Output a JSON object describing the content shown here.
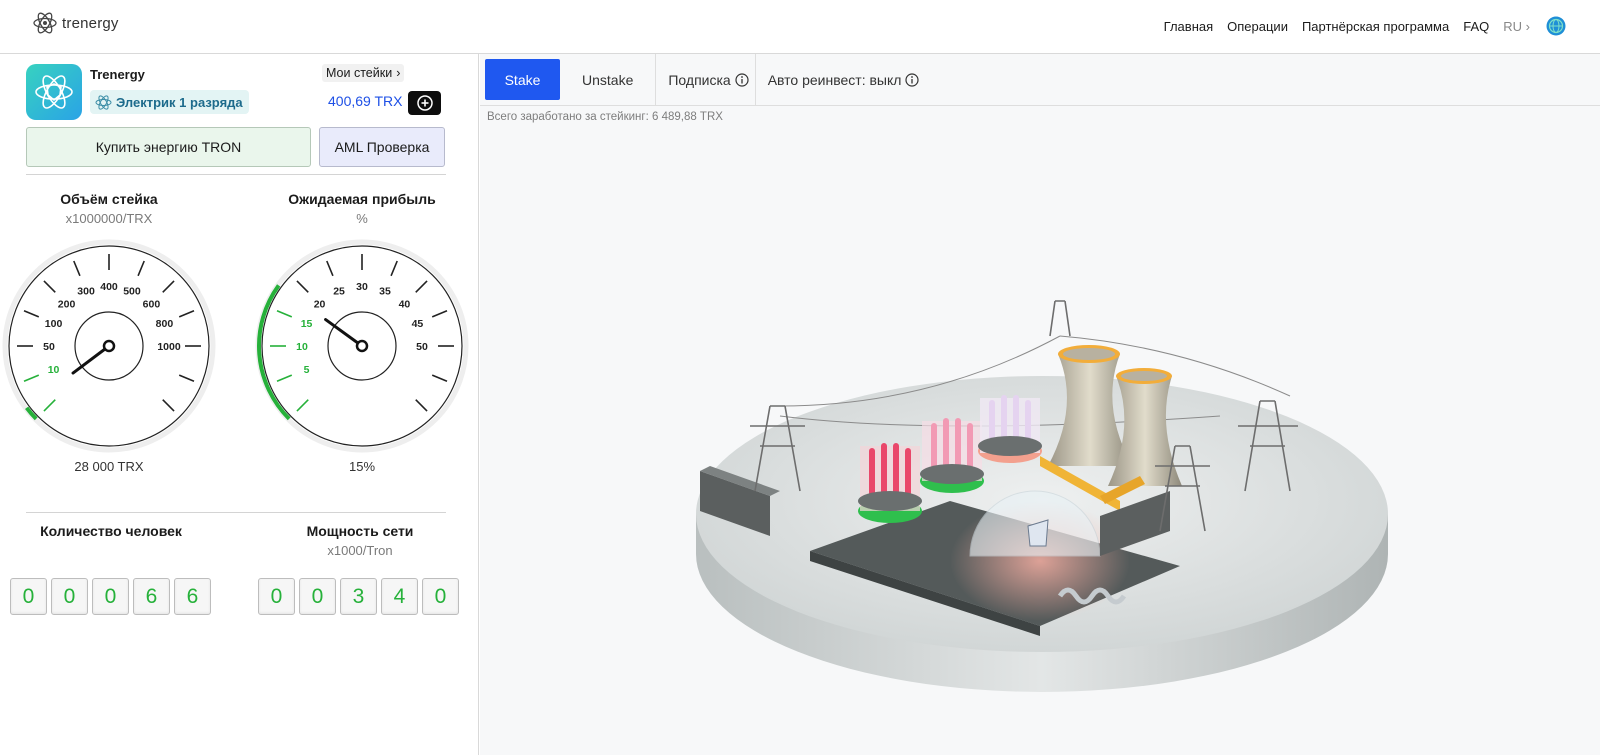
{
  "header": {
    "logo_text": "trenergy",
    "nav": [
      "Главная",
      "Операции",
      "Партнёрская программа",
      "FAQ"
    ],
    "lang": "RU"
  },
  "profile": {
    "name": "Trenergy",
    "rank": "Электрик 1 разряда",
    "my_stakes": "Мои стейки",
    "balance": "400,69 TRX"
  },
  "actions": {
    "buy_energy": "Купить энергию TRON",
    "aml": "AML Проверка"
  },
  "gauge_stake": {
    "title": "Объём стейка",
    "unit": "x1000000/TRX",
    "ticks": [
      "10",
      "50",
      "100",
      "200",
      "300",
      "400",
      "500",
      "600",
      "800",
      "1000"
    ],
    "value": "28 000 TRX",
    "level_fraction": 0.03
  },
  "gauge_profit": {
    "title": "Ожидаемая прибыль",
    "unit": "%",
    "ticks": [
      "5",
      "10",
      "15",
      "20",
      "25",
      "30",
      "35",
      "40",
      "45",
      "50"
    ],
    "value": "15%",
    "level_fraction": 0.3
  },
  "people": {
    "title": "Количество человек",
    "digits": [
      "0",
      "0",
      "0",
      "6",
      "6"
    ]
  },
  "power": {
    "title": "Мощность сети",
    "unit": "x1000/Tron",
    "digits": [
      "0",
      "0",
      "3",
      "4",
      "0"
    ]
  },
  "tabs": {
    "stake": "Stake",
    "unstake": "Unstake",
    "subscription": "Подписка",
    "auto_reinvest": "Авто реинвест: выкл"
  },
  "earned_text": "Всего заработано за стейкинг: 6 489,88 TRX",
  "colors": {
    "accent_blue": "#1f58f0",
    "green": "#26b13a",
    "dark_button": "#0d0d0d"
  }
}
